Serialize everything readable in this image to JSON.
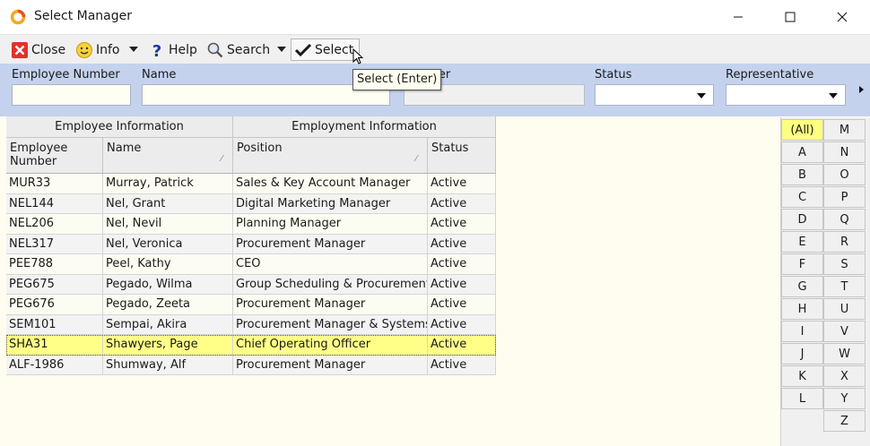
{
  "window": {
    "title": "Select Manager"
  },
  "toolbar": {
    "close_label": "Close",
    "info_label": "Info",
    "help_label": "Help",
    "search_label": "Search",
    "select_label": "Select"
  },
  "tooltip": {
    "text": "Select (Enter)"
  },
  "filters": {
    "employee_number_label": "Employee Number",
    "name_label": "Name",
    "number_label": "Number",
    "status_label": "Status",
    "representative_label": "Representative",
    "employee_number_value": "",
    "name_value": "",
    "number_value": "",
    "status_value": "",
    "representative_value": ""
  },
  "grid": {
    "bands": [
      "Employee Information",
      "Employment Information"
    ],
    "columns": [
      "Employee Number",
      "Name",
      "Position",
      "Status"
    ],
    "rows": [
      [
        "MUR33",
        "Murray, Patrick",
        "Sales & Key Account Manager",
        "Active"
      ],
      [
        "NEL144",
        "Nel, Grant",
        "Digital Marketing Manager",
        "Active"
      ],
      [
        "NEL206",
        "Nel, Nevil",
        "Planning Manager",
        "Active"
      ],
      [
        "NEL317",
        "Nel, Veronica",
        "Procurement Manager",
        "Active"
      ],
      [
        "PEE788",
        "Peel, Kathy",
        "CEO",
        "Active"
      ],
      [
        "PEG675",
        "Pegado, Wilma",
        "Group Scheduling & Procurement O",
        "Active"
      ],
      [
        "PEG676",
        "Pegado, Zeeta",
        "Procurement Manager",
        "Active"
      ],
      [
        "SEM101",
        "Sempai, Akira",
        "Procurement Manager & Systems Ac",
        "Active"
      ],
      [
        "SHA31",
        "Shawyers, Page",
        "Chief Operating Officer",
        "Active"
      ],
      [
        "ALF-1986",
        "Shumway, Alf",
        "Procurement Manager",
        "Active"
      ]
    ],
    "selected_row": 8
  },
  "alpha_index": {
    "left": [
      "(All)",
      "A",
      "B",
      "C",
      "D",
      "E",
      "F",
      "G",
      "H",
      "I",
      "J",
      "K",
      "L"
    ],
    "right": [
      "M",
      "N",
      "O",
      "P",
      "Q",
      "R",
      "S",
      "T",
      "U",
      "V",
      "W",
      "X",
      "Y",
      "Z"
    ],
    "active": "(All)"
  },
  "colors": {
    "filter_panel": "#c4d2ee",
    "selected_row": "#ffff88",
    "body_background": "#fefdf0",
    "active_index": "#ffff80"
  }
}
